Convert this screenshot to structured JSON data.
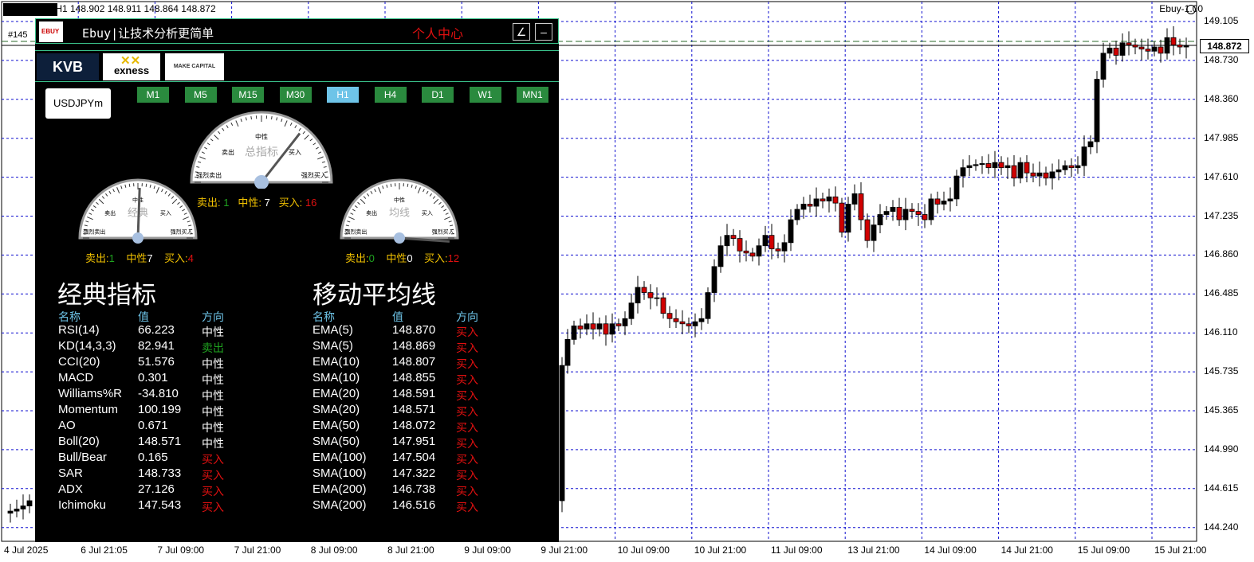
{
  "chart": {
    "ohlc_text": ",H1  148.902 148.911 148.864 148.872",
    "indicator_tag": "Ebuy-1.00",
    "current_price": "148.872",
    "price_levels": [
      "149.105",
      "148.730",
      "148.360",
      "147.985",
      "147.610",
      "147.235",
      "146.860",
      "146.485",
      "146.110",
      "145.735",
      "145.365",
      "144.990",
      "144.615",
      "144.240"
    ],
    "time_labels": [
      "4 Jul 2025",
      "6 Jul 21:05",
      "7 Jul 09:00",
      "7 Jul 21:00",
      "8 Jul 09:00",
      "8 Jul 21:00",
      "9 Jul 09:00",
      "9 Jul 21:00",
      "10 Jul 09:00",
      "10 Jul 21:00",
      "11 Jul 09:00",
      "13 Jul 21:00",
      "14 Jul 09:00",
      "14 Jul 21:00",
      "15 Jul 09:00",
      "15 Jul 21:00"
    ],
    "colors": {
      "grid": "#1010d0",
      "bull": "#000000",
      "bear": "#d00000",
      "current_line": "#2a6a2a"
    }
  },
  "panel": {
    "order_tag": "#145",
    "logo_text": "EBUY",
    "brand": "Ebuy|让技术分析更简单",
    "center_link": "个人中心",
    "btn_tool": "∠",
    "btn_min": "–",
    "brokers": {
      "kvb": "KVB",
      "exness": "exness",
      "makecap": "MAKE CAPITAL"
    },
    "symbol": "USDJPYm",
    "timeframes": [
      "M1",
      "M5",
      "M15",
      "M30",
      "H1",
      "H4",
      "D1",
      "W1",
      "MN1"
    ],
    "active_timeframe": "H1",
    "gauge_main": {
      "title": "总指标",
      "sell_label": "卖出:",
      "sell": "1",
      "neutral_label": "中性:",
      "neutral": "7",
      "buy_label": "买入:",
      "buy": "16"
    },
    "gauge_classic": {
      "title": "经典",
      "sell_label": "卖出:",
      "sell": "1",
      "neutral_label": "中性",
      "neutral": "7",
      "buy_label": "买入:",
      "buy": "4"
    },
    "gauge_ma": {
      "title": "均线",
      "sell_label": "卖出:",
      "sell": "0",
      "neutral_label": "中性",
      "neutral": "0",
      "buy_label": "买入:",
      "buy": "12"
    },
    "gauge_labels": {
      "strong_sell": "强烈卖出",
      "sell": "卖出",
      "neutral": "中性",
      "buy": "买入",
      "strong_buy": "强烈买入"
    },
    "classic": {
      "title": "经典指标",
      "headers": {
        "name": "名称",
        "value": "值",
        "dir": "方向"
      },
      "rows": [
        {
          "name": "RSI(14)",
          "value": "66.223",
          "dir": "中性",
          "color": "#ffffff"
        },
        {
          "name": "KD(14,3,3)",
          "value": "82.941",
          "dir": "卖出",
          "color": "#1fa31f"
        },
        {
          "name": "CCI(20)",
          "value": "51.576",
          "dir": "中性",
          "color": "#ffffff"
        },
        {
          "name": "MACD",
          "value": "0.301",
          "dir": "中性",
          "color": "#ffffff"
        },
        {
          "name": "Williams%R",
          "value": "-34.810",
          "dir": "中性",
          "color": "#ffffff"
        },
        {
          "name": "Momentum",
          "value": "100.199",
          "dir": "中性",
          "color": "#ffffff"
        },
        {
          "name": "AO",
          "value": "0.671",
          "dir": "中性",
          "color": "#ffffff"
        },
        {
          "name": "Boll(20)",
          "value": "148.571",
          "dir": "中性",
          "color": "#ffffff"
        },
        {
          "name": "Bull/Bear",
          "value": "0.165",
          "dir": "买入",
          "color": "#e01010"
        },
        {
          "name": "SAR",
          "value": "148.733",
          "dir": "买入",
          "color": "#e01010"
        },
        {
          "name": "ADX",
          "value": "27.126",
          "dir": "买入",
          "color": "#e01010"
        },
        {
          "name": "Ichimoku",
          "value": "147.543",
          "dir": "买入",
          "color": "#e01010"
        }
      ]
    },
    "ma": {
      "title": "移动平均线",
      "headers": {
        "name": "名称",
        "value": "值",
        "dir": "方向"
      },
      "rows": [
        {
          "name": "EMA(5)",
          "value": "148.870",
          "dir": "买入",
          "color": "#e01010"
        },
        {
          "name": "SMA(5)",
          "value": "148.869",
          "dir": "买入",
          "color": "#e01010"
        },
        {
          "name": "EMA(10)",
          "value": "148.807",
          "dir": "买入",
          "color": "#e01010"
        },
        {
          "name": "SMA(10)",
          "value": "148.855",
          "dir": "买入",
          "color": "#e01010"
        },
        {
          "name": "EMA(20)",
          "value": "148.591",
          "dir": "买入",
          "color": "#e01010"
        },
        {
          "name": "SMA(20)",
          "value": "148.571",
          "dir": "买入",
          "color": "#e01010"
        },
        {
          "name": "EMA(50)",
          "value": "148.072",
          "dir": "买入",
          "color": "#e01010"
        },
        {
          "name": "SMA(50)",
          "value": "147.951",
          "dir": "买入",
          "color": "#e01010"
        },
        {
          "name": "EMA(100)",
          "value": "147.504",
          "dir": "买入",
          "color": "#e01010"
        },
        {
          "name": "SMA(100)",
          "value": "147.322",
          "dir": "买入",
          "color": "#e01010"
        },
        {
          "name": "EMA(200)",
          "value": "146.738",
          "dir": "买入",
          "color": "#e01010"
        },
        {
          "name": "SMA(200)",
          "value": "146.516",
          "dir": "买入",
          "color": "#e01010"
        }
      ]
    }
  }
}
